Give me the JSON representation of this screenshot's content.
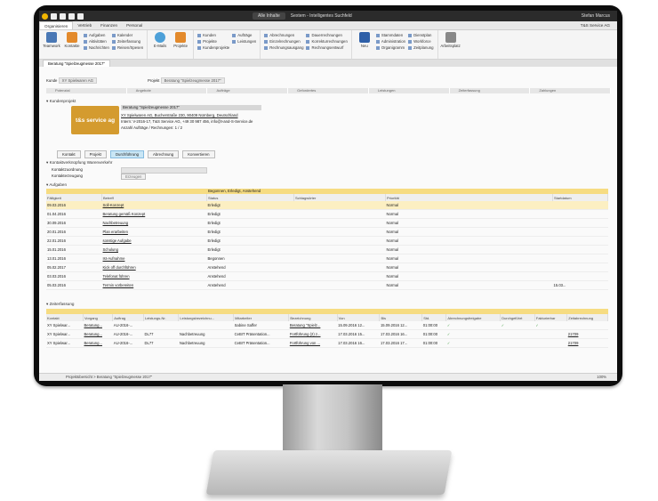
{
  "titlebar": {
    "search": "Alle Inhalte",
    "center": "Sextem - Intelligentes Suchfeld",
    "user": "Stefan Marcus"
  },
  "tabs": [
    "Organisieren",
    "Vertrieb",
    "Finanzen",
    "Personal"
  ],
  "company": "T&S Service AG",
  "ribbon": {
    "teamwork": "Teamwork",
    "kontakte": "Kontakte",
    "col1": [
      "Aufgaben",
      "Aktivitäten",
      "Nachrichten"
    ],
    "col2": [
      "Kalender",
      "Zeiterfassung",
      "Reisen/Spesen"
    ],
    "email": "E-Mails",
    "projekte": "Projekte",
    "col3": [
      "Kunden",
      "Projekte",
      "Kundenprojekte"
    ],
    "col4": [
      "Aufträge",
      "Leistungen"
    ],
    "col5": [
      "Abrechnungen",
      "Einzelrechnungen",
      "Rechnungsausgang"
    ],
    "col6": [
      "Dauerrechnungen",
      "Korrekturrechnungen",
      "Rechnungsentwurf"
    ],
    "neu": "Neu",
    "col7": [
      "Stammdaten",
      "Administration",
      "Organigramm"
    ],
    "col8": [
      "Dienstplan",
      "Workforce",
      "Zeitplanung"
    ],
    "arbeitsplatz": "Arbeitsplatz"
  },
  "doctab": "Beratung \"Spielzeugmesse 2017\"",
  "header": {
    "kunde_label": "Kunde",
    "kunde_value": "XY Spielwaren AG",
    "projekt_label": "Projekt",
    "projekt_value": "Beratung \"Spielzeugmesse 2017\""
  },
  "steps": [
    "Potenzial",
    "Angebote",
    "Aufträge",
    "Gefordertes",
    "Leistungen",
    "Zeiterfassung",
    "Zahlungen"
  ],
  "kundenprojekt": {
    "section": "Kundenprojekt",
    "logo": "t&s service ag",
    "title": "Beratung \"Spielzeugmesse 2017\"",
    "line1": "XY Spielwaren AG, Bucherstraße 230, 90409 Nürnberg, Deutschland",
    "line2": "Intern: V-2016-17, T&S Service AG, +49 30 987 456, info@t-and-S-Service.de",
    "line3": "Anzahl Aufträge / Rechnungen: 1 / 2"
  },
  "buttons": [
    "Kontakt",
    "Projekt",
    "Durchführung",
    "Abrechnung",
    "Konvertieren"
  ],
  "verknuepfung": {
    "section": "Kontaktverknüpfung Warenverkehr",
    "zuordnung": "Kontaktzuordnung",
    "erzeugung": "Kontakterzeugung",
    "btn": "Erzeugen"
  },
  "aufgaben": {
    "section": "Aufgaben",
    "filter": "Begonnen, Erledigt, Anstehend",
    "columns": [
      "Fälligkeit",
      "Betreff",
      "Status",
      "Schlagwörter",
      "Priorität",
      "Startdatum"
    ],
    "rows": [
      [
        "09.03.2016",
        "Soll-Konzept",
        "Erledigt",
        "",
        "Normal",
        ""
      ],
      [
        "01.04.2016",
        "Beratung gemäß Konzept",
        "Erledigt",
        "",
        "Normal",
        ""
      ],
      [
        "30.09.2016",
        "Nachbetreuung",
        "Erledigt",
        "",
        "Normal",
        ""
      ],
      [
        "20.01.2016",
        "Plan erarbeiten",
        "Erledigt",
        "",
        "Normal",
        ""
      ],
      [
        "22.01.2016",
        "sonstige Aufgabe",
        "Erledigt",
        "",
        "Normal",
        ""
      ],
      [
        "15.01.2016",
        "Schulung",
        "Erledigt",
        "",
        "Normal",
        ""
      ],
      [
        "13.01.2016",
        "Ist-Aufnahme",
        "Begonnen",
        "",
        "Normal",
        ""
      ],
      [
        "05.02.2017",
        "Kick off durchführen",
        "Anstehend",
        "",
        "Normal",
        ""
      ],
      [
        "03.03.2016",
        "Telefonat führen",
        "Anstehend",
        "",
        "Normal",
        ""
      ],
      [
        "05.03.2016",
        "Termin vorbereiten",
        "Anstehend",
        "",
        "Normal",
        "15.03..."
      ]
    ]
  },
  "zeiterfassung": {
    "section": "Zeiterfassung",
    "columns": [
      "Kontakt",
      "Vorgang",
      "Auftrag",
      "Leistungs-Nr.",
      "Leistungsbezeichnu...",
      "Mitarbeiter",
      "Bezeichnung",
      "Von",
      "Bis",
      "Std.",
      "Abrechnungsfreigabe",
      "Durchgeführt",
      "Fakturierbar",
      "Zeitabrechnung"
    ],
    "rows": [
      [
        "XY Spielwar...",
        "Beratung...",
        "AU-2016-...",
        "",
        "",
        "Sabine Saffer",
        "Beratung \"Spielz...",
        "15.09.2016 12...",
        "15.09.2016 12...",
        "01:00:00",
        "✓",
        "✓",
        "✓",
        ""
      ],
      [
        "XY Spielwar...",
        "Beratung...",
        "AU-2016-...",
        "DL77",
        "Nachbetreuung",
        "CeBIT Präsentation...",
        "Fortführung (2) z...",
        "17.03.2016 15...",
        "17.03.2016 16...",
        "01:00:00",
        "✓",
        "",
        "",
        "21709"
      ],
      [
        "XY Spielwar...",
        "Beratung...",
        "AU-2016-...",
        "DL77",
        "Nachbetreuung",
        "CeBIT Präsentation...",
        "Fortführung von ...",
        "17.03.2016 16...",
        "17.03.2016 17...",
        "01:00:00",
        "✓",
        "",
        "",
        "21709"
      ]
    ]
  },
  "status": {
    "path": "Projektübersicht > Beratung \"Spielzeugmesse 2017\"",
    "zoom": "100%"
  }
}
